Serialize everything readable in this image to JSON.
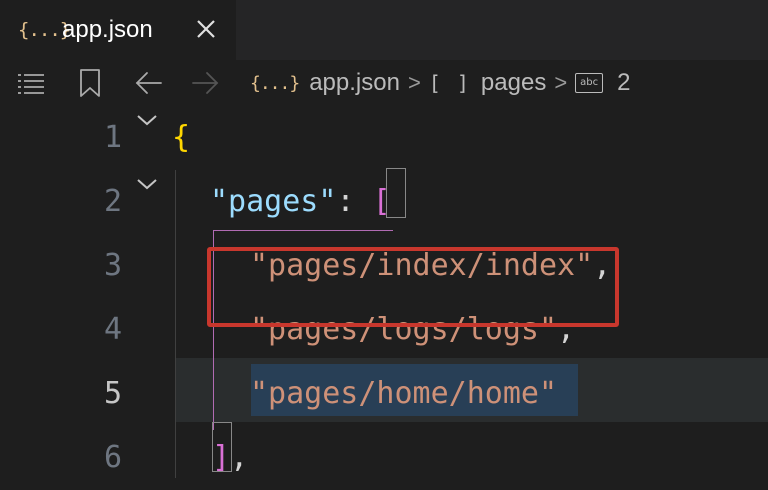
{
  "tab": {
    "file_icon": "{...}",
    "label": "app.json",
    "close_icon": "close-icon"
  },
  "toolbar": {
    "icons": [
      "list-icon",
      "bookmark-icon",
      "back-arrow-icon",
      "forward-arrow-icon"
    ]
  },
  "breadcrumb": {
    "file_icon": "{...}",
    "file": "app.json",
    "separator": ">",
    "array_icon": "[ ]",
    "array_name": "pages",
    "string_icon": "abc",
    "item": "2"
  },
  "editor": {
    "line_numbers": [
      "1",
      "2",
      "3",
      "4",
      "5",
      "6"
    ],
    "current_line": "5",
    "lines": {
      "l1_brace": "{",
      "l2_key": "\"pages\"",
      "l2_colon": ": ",
      "l2_bracket": "[",
      "l3_value": "\"pages/index/index\"",
      "l3_comma": ",",
      "l4_value": "\"pages/logs/logs\"",
      "l4_comma": ",",
      "l5_value": "\"pages/home/home\"",
      "l6_bracket": "]",
      "l6_comma": ","
    }
  },
  "colors": {
    "string": "#ce9178",
    "key": "#9cdcfe",
    "brace": "#ffd700",
    "bracket": "#da70d6",
    "highlight_box": "#c8372d"
  }
}
